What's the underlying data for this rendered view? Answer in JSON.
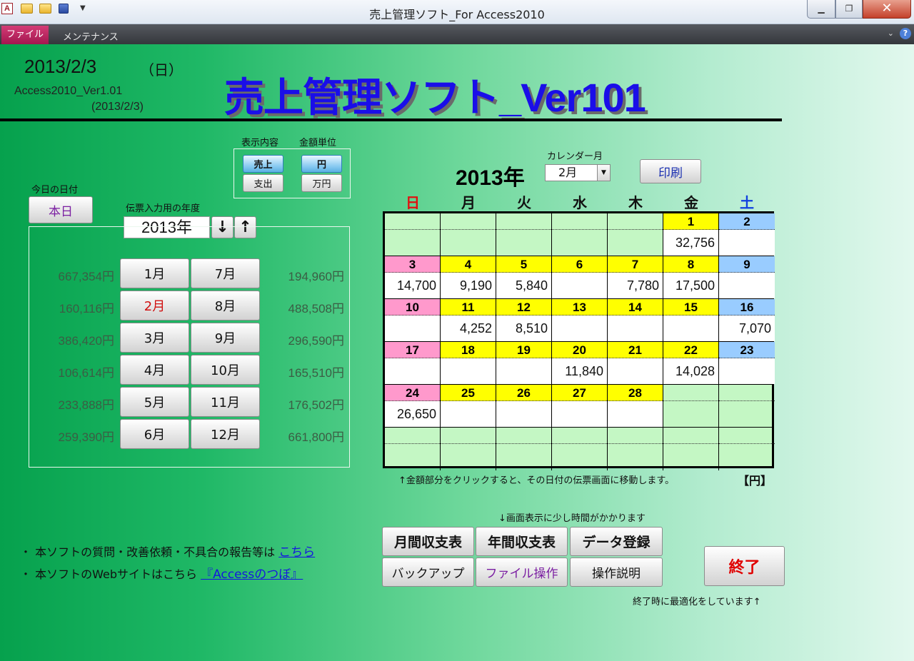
{
  "window": {
    "title": "売上管理ソフト_For Access2010",
    "app_icon": "A",
    "min_label": "▁",
    "max_label": "❐",
    "close_label": "✕"
  },
  "ribbon": {
    "file_tab": "ファイル",
    "maintenance_tab": "メンテナンス",
    "collapse_label": "⌄",
    "help_label": "?"
  },
  "header": {
    "date": "2013/2/3",
    "day_of_week": "（日）",
    "version": "Access2010_Ver1.01",
    "version_date": "(2013/2/3)",
    "title": "売上管理ソフト_Ver101"
  },
  "today": {
    "label": "今日の日付",
    "button": "本日"
  },
  "display": {
    "content_label": "表示内容",
    "unit_label": "金額単位",
    "sales_button": "売上",
    "expense_button": "支出",
    "yen_button": "円",
    "man_yen_button": "万円"
  },
  "year_select": {
    "label": "伝票入力用の年度",
    "value": "2013年",
    "down_label": "↓",
    "up_label": "↑"
  },
  "months": [
    {
      "left_amount": "667,354円",
      "left_label": "1月",
      "right_label": "7月",
      "right_amount": "194,960円"
    },
    {
      "left_amount": "160,116円",
      "left_label": "2月",
      "right_label": "8月",
      "right_amount": "488,508円"
    },
    {
      "left_amount": "386,420円",
      "left_label": "3月",
      "right_label": "9月",
      "right_amount": "296,590円"
    },
    {
      "left_amount": "106,614円",
      "left_label": "4月",
      "right_label": "10月",
      "right_amount": "165,510円"
    },
    {
      "left_amount": "233,888円",
      "left_label": "5月",
      "right_label": "11月",
      "right_amount": "176,502円"
    },
    {
      "left_amount": "259,390円",
      "left_label": "6月",
      "right_label": "12月",
      "right_amount": "661,800円"
    }
  ],
  "calendar": {
    "year_label": "2013年",
    "month_label": "カレンダー月",
    "month_value": "2月",
    "month_drop": "▼",
    "print_button": "印刷",
    "weekdays": [
      "日",
      "月",
      "火",
      "水",
      "木",
      "金",
      "土"
    ],
    "weeks": [
      [
        {
          "d": "",
          "a": ""
        },
        {
          "d": "",
          "a": ""
        },
        {
          "d": "",
          "a": ""
        },
        {
          "d": "",
          "a": ""
        },
        {
          "d": "",
          "a": ""
        },
        {
          "d": "1",
          "a": "32,756"
        },
        {
          "d": "2",
          "a": ""
        }
      ],
      [
        {
          "d": "3",
          "a": "14,700"
        },
        {
          "d": "4",
          "a": "9,190"
        },
        {
          "d": "5",
          "a": "5,840"
        },
        {
          "d": "6",
          "a": ""
        },
        {
          "d": "7",
          "a": "7,780"
        },
        {
          "d": "8",
          "a": "17,500"
        },
        {
          "d": "9",
          "a": ""
        }
      ],
      [
        {
          "d": "10",
          "a": ""
        },
        {
          "d": "11",
          "a": "4,252"
        },
        {
          "d": "12",
          "a": "8,510"
        },
        {
          "d": "13",
          "a": ""
        },
        {
          "d": "14",
          "a": ""
        },
        {
          "d": "15",
          "a": ""
        },
        {
          "d": "16",
          "a": "7,070"
        }
      ],
      [
        {
          "d": "17",
          "a": ""
        },
        {
          "d": "18",
          "a": ""
        },
        {
          "d": "19",
          "a": ""
        },
        {
          "d": "20",
          "a": "11,840"
        },
        {
          "d": "21",
          "a": ""
        },
        {
          "d": "22",
          "a": "14,028"
        },
        {
          "d": "23",
          "a": ""
        }
      ],
      [
        {
          "d": "24",
          "a": "26,650"
        },
        {
          "d": "25",
          "a": ""
        },
        {
          "d": "26",
          "a": ""
        },
        {
          "d": "27",
          "a": ""
        },
        {
          "d": "28",
          "a": ""
        },
        {
          "d": "",
          "a": ""
        },
        {
          "d": "",
          "a": ""
        }
      ],
      [
        {
          "d": "",
          "a": ""
        },
        {
          "d": "",
          "a": ""
        },
        {
          "d": "",
          "a": ""
        },
        {
          "d": "",
          "a": ""
        },
        {
          "d": "",
          "a": ""
        },
        {
          "d": "",
          "a": ""
        },
        {
          "d": "",
          "a": ""
        }
      ]
    ],
    "note": "↑金額部分をクリックすると、その日付の伝票画面に移動します。",
    "unit": "【円】"
  },
  "actions": {
    "slow_note": "↓画面表示に少し時間がかかります",
    "monthly": "月間収支表",
    "yearly": "年間収支表",
    "data_entry": "データ登録",
    "backup": "バックアップ",
    "file_ops": "ファイル操作",
    "manual": "操作説明",
    "exit": "終了",
    "exit_note": "終了時に最適化をしています↑"
  },
  "footer": {
    "line1_prefix": "・ 本ソフトの質問・改善依頼・不具合の報告等は",
    "line1_link": "こちら",
    "line2_prefix": "・ 本ソフトのWebサイトはこちら",
    "line2_link": "『Accessのつぼ』"
  },
  "colors": {
    "title_blue": "#1a0ee8",
    "weekday_yellow": "#ffff00",
    "sunday_pink": "#ff99cc",
    "saturday_blue": "#99ccff",
    "empty_green": "#c4f7c4",
    "file_tab": "#c2185b"
  }
}
